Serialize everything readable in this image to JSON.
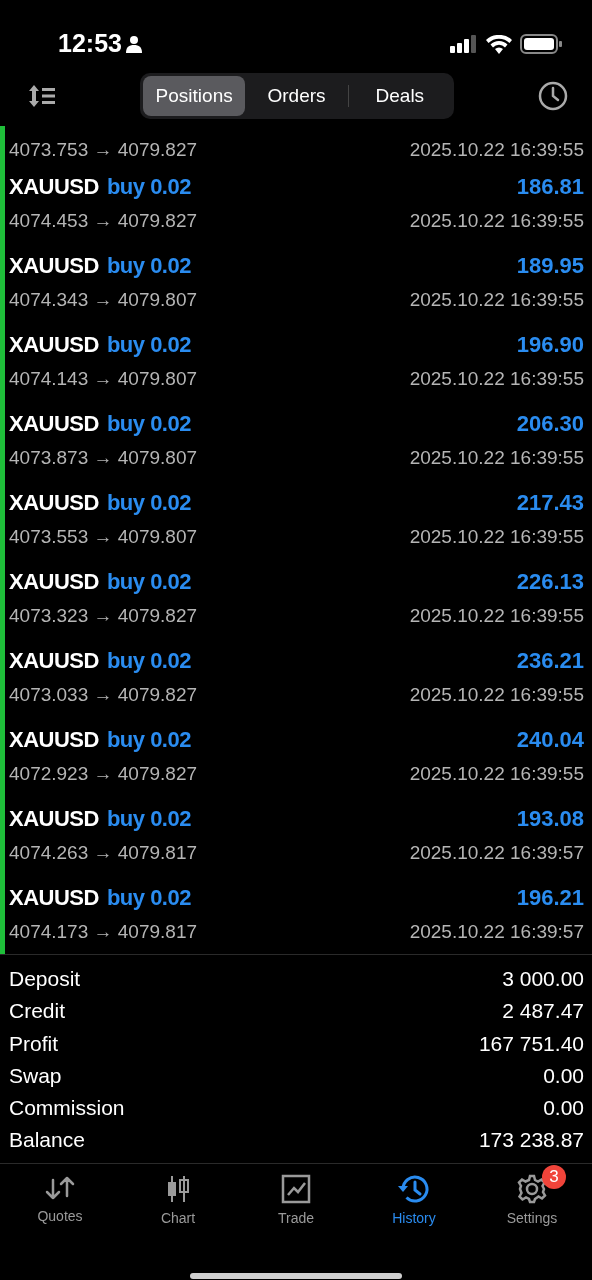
{
  "status_bar": {
    "time": "12:53"
  },
  "tabs": [
    {
      "label": "Positions",
      "selected": true
    },
    {
      "label": "Orders",
      "selected": false
    },
    {
      "label": "Deals",
      "selected": false
    }
  ],
  "partial_row": {
    "prices": "4073.753 → 4079.827",
    "time": "2025.10.22 16:39:55"
  },
  "deals": [
    {
      "symbol": "XAUUSD",
      "side": "buy 0.02",
      "profit": "186.81",
      "prices": "4074.453 → 4079.827",
      "time": "2025.10.22 16:39:55"
    },
    {
      "symbol": "XAUUSD",
      "side": "buy 0.02",
      "profit": "189.95",
      "prices": "4074.343 → 4079.807",
      "time": "2025.10.22 16:39:55"
    },
    {
      "symbol": "XAUUSD",
      "side": "buy 0.02",
      "profit": "196.90",
      "prices": "4074.143 → 4079.807",
      "time": "2025.10.22 16:39:55"
    },
    {
      "symbol": "XAUUSD",
      "side": "buy 0.02",
      "profit": "206.30",
      "prices": "4073.873 → 4079.807",
      "time": "2025.10.22 16:39:55"
    },
    {
      "symbol": "XAUUSD",
      "side": "buy 0.02",
      "profit": "217.43",
      "prices": "4073.553 → 4079.807",
      "time": "2025.10.22 16:39:55"
    },
    {
      "symbol": "XAUUSD",
      "side": "buy 0.02",
      "profit": "226.13",
      "prices": "4073.323 → 4079.827",
      "time": "2025.10.22 16:39:55"
    },
    {
      "symbol": "XAUUSD",
      "side": "buy 0.02",
      "profit": "236.21",
      "prices": "4073.033 → 4079.827",
      "time": "2025.10.22 16:39:55"
    },
    {
      "symbol": "XAUUSD",
      "side": "buy 0.02",
      "profit": "240.04",
      "prices": "4072.923 → 4079.827",
      "time": "2025.10.22 16:39:55"
    },
    {
      "symbol": "XAUUSD",
      "side": "buy 0.02",
      "profit": "193.08",
      "prices": "4074.263 → 4079.817",
      "time": "2025.10.22 16:39:57"
    },
    {
      "symbol": "XAUUSD",
      "side": "buy 0.02",
      "profit": "196.21",
      "prices": "4074.173 → 4079.817",
      "time": "2025.10.22 16:39:57"
    }
  ],
  "summary": [
    {
      "label": "Deposit",
      "value": "3 000.00"
    },
    {
      "label": "Credit",
      "value": "2 487.47"
    },
    {
      "label": "Profit",
      "value": "167 751.40"
    },
    {
      "label": "Swap",
      "value": "0.00"
    },
    {
      "label": "Commission",
      "value": "0.00"
    },
    {
      "label": "Balance",
      "value": "173 238.87"
    }
  ],
  "tab_bar": [
    {
      "kind": "quotes",
      "label": "Quotes",
      "selected": false
    },
    {
      "kind": "chart",
      "label": "Chart",
      "selected": false
    },
    {
      "kind": "trade",
      "label": "Trade",
      "selected": false
    },
    {
      "kind": "history",
      "label": "History",
      "selected": true
    },
    {
      "kind": "settings",
      "label": "Settings",
      "selected": false,
      "badge": "3"
    }
  ]
}
